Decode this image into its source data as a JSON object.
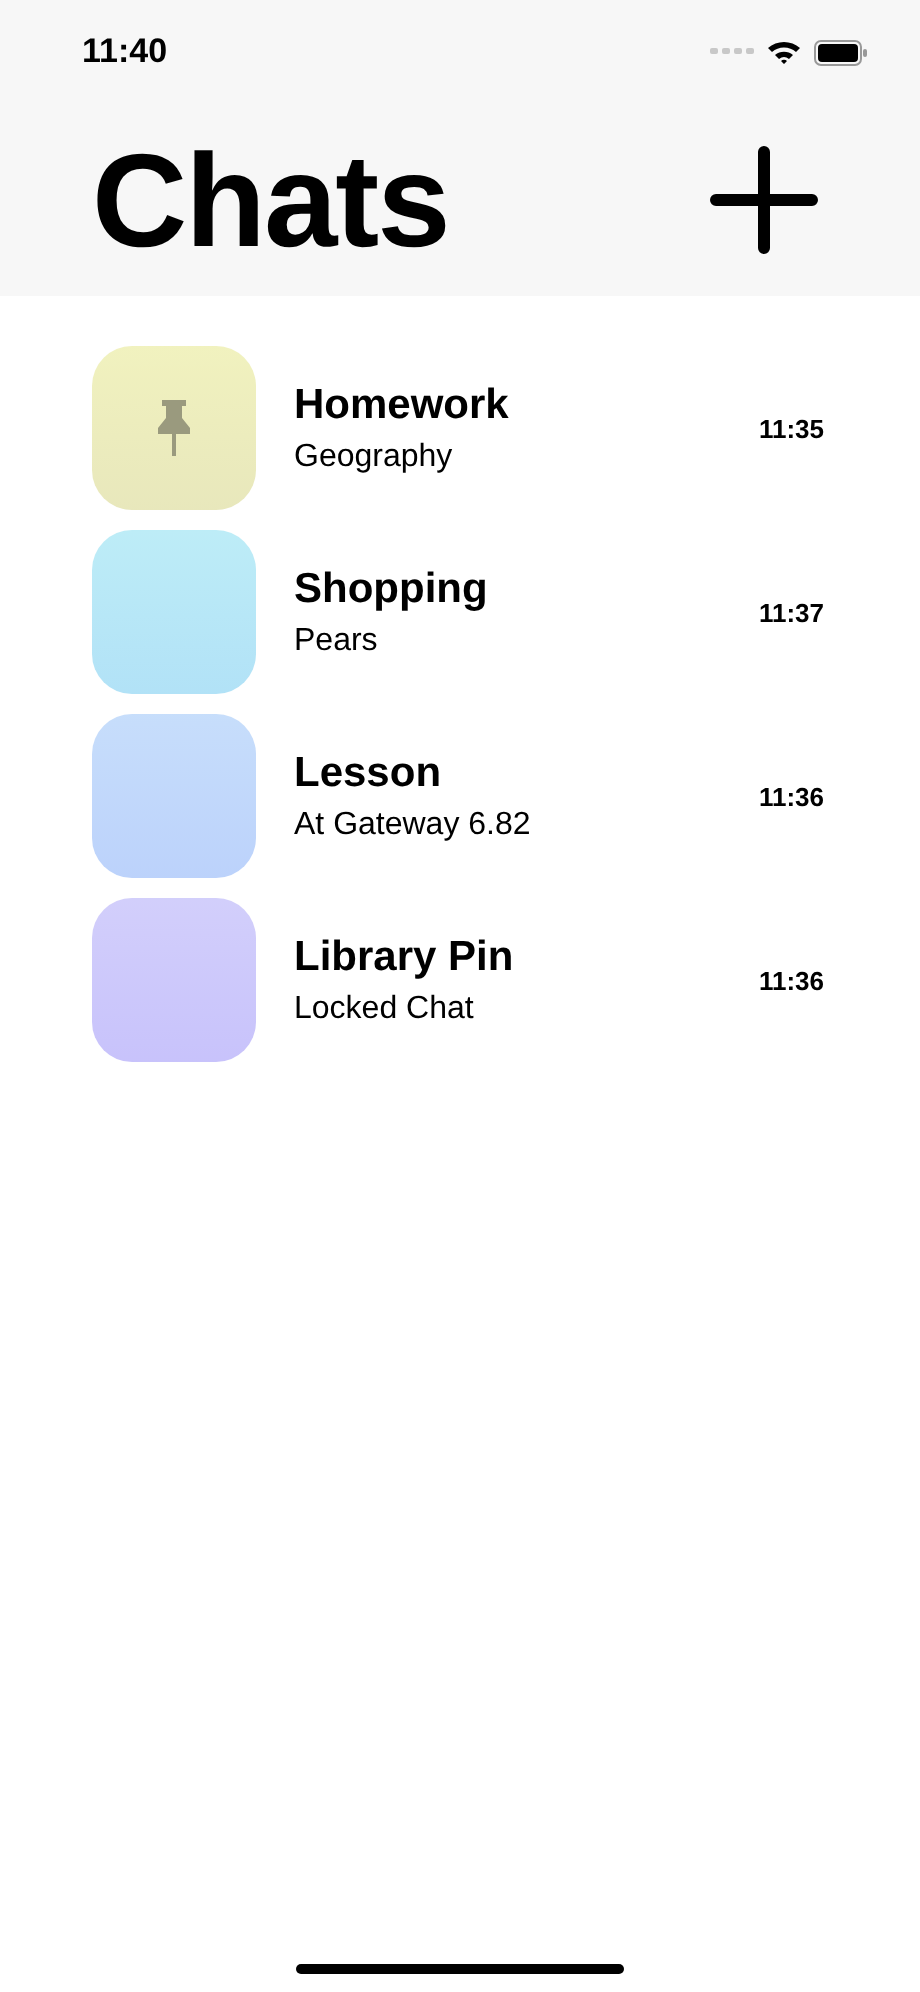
{
  "status_bar": {
    "time": "11:40"
  },
  "header": {
    "title": "Chats"
  },
  "chats": [
    {
      "name": "Homework",
      "preview": "Geography",
      "time": "11:35",
      "pinned": true,
      "color": "#eff0b6"
    },
    {
      "name": "Shopping",
      "preview": "Pears",
      "time": "11:37",
      "pinned": false,
      "color": "#b4eaf6"
    },
    {
      "name": "Lesson",
      "preview": "At Gateway 6.82",
      "time": "11:36",
      "pinned": false,
      "color": "#bfd9fb"
    },
    {
      "name": "Library Pin",
      "preview": "Locked Chat",
      "time": "11:36",
      "pinned": false,
      "color": "#ccc8fb"
    }
  ]
}
